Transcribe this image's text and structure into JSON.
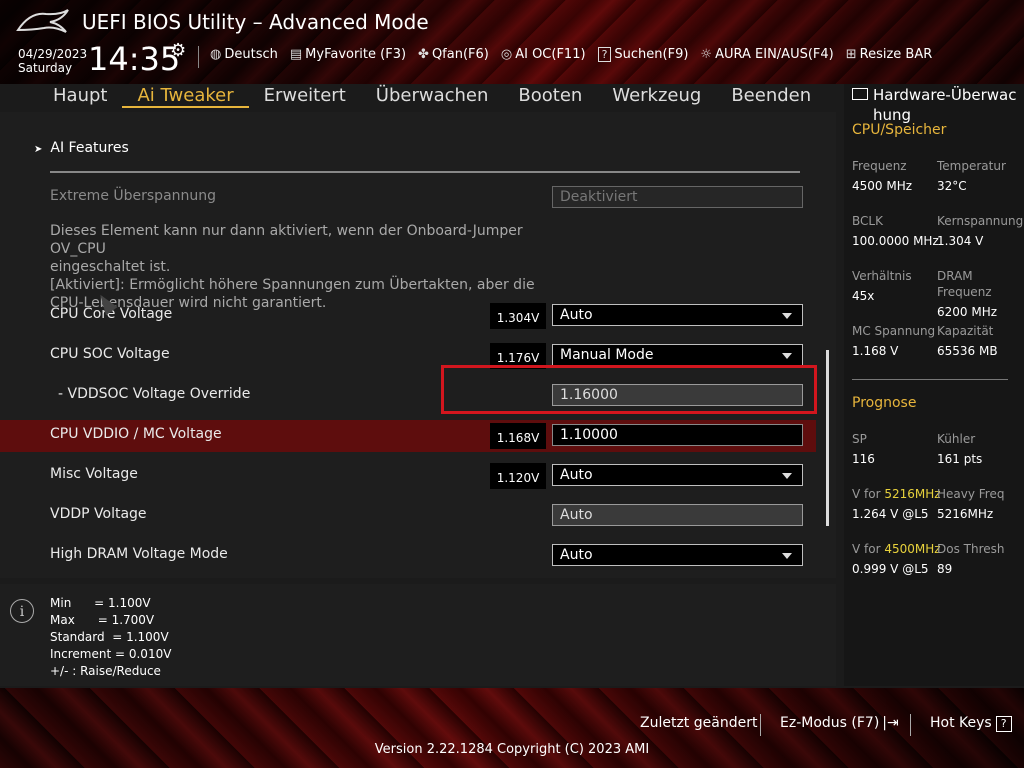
{
  "header": {
    "title": "UEFI BIOS Utility – Advanced Mode",
    "date": "04/29/2023",
    "day": "Saturday",
    "time": "14:35",
    "toolbar": [
      {
        "icon": "globe-icon",
        "label": "Deutsch"
      },
      {
        "icon": "favorite-icon",
        "label": "MyFavorite (F3)"
      },
      {
        "icon": "fan-icon",
        "label": "Qfan(F6)"
      },
      {
        "icon": "ai-chip-icon",
        "label": "AI OC(F11)"
      },
      {
        "icon": "search-question-icon",
        "label": "Suchen(F9)"
      },
      {
        "icon": "aura-light-icon",
        "label": "AURA EIN/AUS(F4)"
      },
      {
        "icon": "resize-bar-icon",
        "label": "Resize BAR"
      }
    ]
  },
  "tabs": [
    "Haupt",
    "Ai Tweaker",
    "Erweitert",
    "Überwachen",
    "Booten",
    "Werkzeug",
    "Beenden"
  ],
  "active_tab": "Ai Tweaker",
  "main": {
    "section": "AI Features",
    "extreme": {
      "label": "Extreme Überspannung",
      "value": "Deaktiviert"
    },
    "help_lines": [
      "Dieses Element kann nur dann aktiviert, wenn der Onboard-Jumper OV_CPU",
      "eingeschaltet ist.",
      "[Aktiviert]: Ermöglicht höhere Spannungen zum Übertakten, aber die",
      "CPU-Lebensdauer wird nicht garantiert."
    ],
    "rows": [
      {
        "label": "CPU Core Voltage",
        "volt": "1.304V",
        "value": "Auto"
      },
      {
        "label": "CPU SOC Voltage",
        "volt": "1.176V",
        "value": "Manual Mode"
      },
      {
        "label": "- VDDSOC Voltage Override",
        "value": "1.16000"
      },
      {
        "label": "CPU VDDIO / MC Voltage",
        "volt": "1.168V",
        "value": "1.10000"
      },
      {
        "label": "Misc Voltage",
        "volt": "1.120V",
        "value": "Auto"
      },
      {
        "label": "VDDP Voltage",
        "value": "Auto"
      },
      {
        "label": "High DRAM Voltage Mode",
        "value": "Auto"
      }
    ]
  },
  "info": {
    "lines": "Min      = 1.100V\nMax      = 1.700V\nStandard  = 1.100V\nIncrement = 0.010V\n+/- : Raise/Reduce"
  },
  "hw": {
    "title": "Hardware-Überwachung",
    "title_line1": "Hardware-Überwac",
    "title_line2": "hung",
    "cpu_section": "CPU/Speicher",
    "freq_lbl": "Frequenz",
    "freq_val": "4500 MHz",
    "temp_lbl": "Temperatur",
    "temp_val": "32°C",
    "bclk_lbl": "BCLK",
    "bclk_val": "100.0000 MHz",
    "core_lbl": "Kernspannung",
    "core_val": "1.304 V",
    "ratio_lbl": "Verhältnis",
    "ratio_val": "45x",
    "dram_lbl1": "DRAM",
    "dram_lbl2": "Frequenz",
    "dram_val": "6200 MHz",
    "mc_lbl": "MC Spannung",
    "mc_val": "1.168 V",
    "cap_lbl": "Kapazität",
    "cap_val": "65536 MB",
    "prog_section": "Prognose",
    "sp_lbl": "SP",
    "sp_val": "116",
    "cool_lbl": "Kühler",
    "cool_val": "161 pts",
    "vfor1_prefix": "V for ",
    "vfor1_freq": "5216MHz",
    "vfor1_val": "1.264 V @L5",
    "heavy_lbl": "Heavy Freq",
    "heavy_val": "5216MHz",
    "vfor2_prefix": "V for ",
    "vfor2_freq": "4500MHz",
    "vfor2_val": "0.999 V @L5",
    "dos_lbl": "Dos Thresh",
    "dos_val": "89"
  },
  "footer": {
    "last_changed": "Zuletzt geändert",
    "ez_mode": "Ez-Modus (F7)",
    "hot_keys": "Hot Keys",
    "hot_keys_key": "?",
    "version": "Version 2.22.1284 Copyright (C) 2023 AMI"
  }
}
